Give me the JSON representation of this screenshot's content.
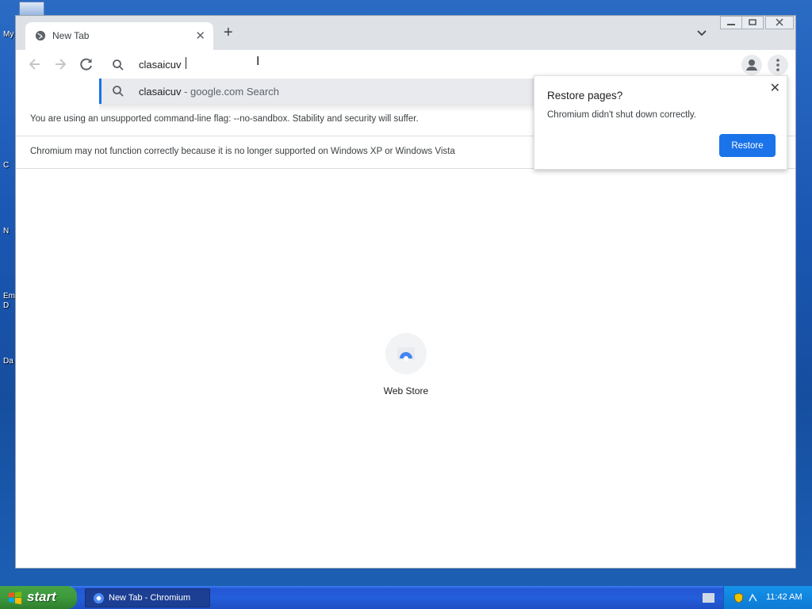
{
  "desktop": {
    "icon_labels": [
      "My",
      "C",
      "N",
      "Em",
      "D",
      "Da"
    ]
  },
  "browser": {
    "tab": {
      "title": "New Tab"
    },
    "omnibox": {
      "value": "clasaicuv",
      "suggestion": {
        "query": "clasaicuv",
        "source": " - google.com Search"
      }
    },
    "infobars": [
      "You are using an unsupported command-line flag: --no-sandbox. Stability and security will suffer.",
      "Chromium may not function correctly because it is no longer supported on Windows XP or Windows Vista"
    ],
    "restore_bubble": {
      "title": "Restore pages?",
      "body": "Chromium didn't shut down correctly.",
      "button": "Restore"
    },
    "shortcut": {
      "label": "Web Store"
    }
  },
  "taskbar": {
    "start_label": "start",
    "task_label": "New Tab - Chromium",
    "clock": "11:42 AM"
  },
  "colors": {
    "accent": "#1a73e8",
    "desktop": "#1b58b4",
    "start_green": "#3c9a3b"
  }
}
